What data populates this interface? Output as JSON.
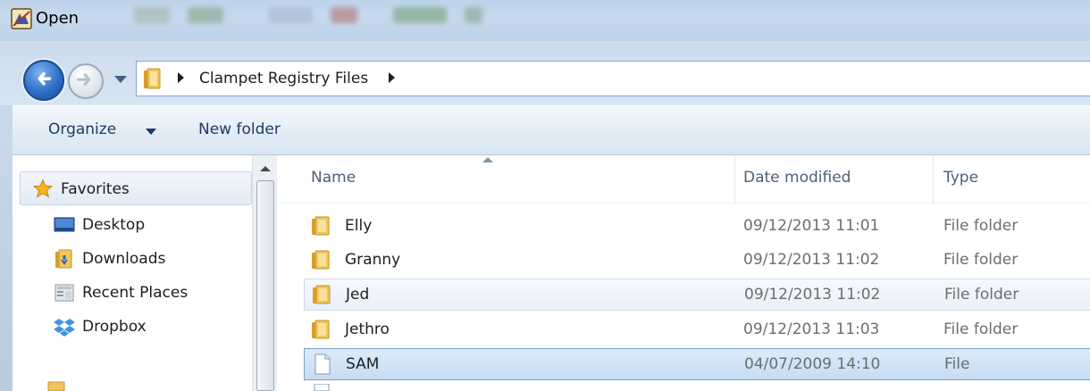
{
  "window": {
    "title": "Open"
  },
  "address": {
    "crumb": "Clampet Registry Files"
  },
  "toolbar": {
    "organize_label": "Organize",
    "new_folder_label": "New folder"
  },
  "navpane": {
    "items": [
      {
        "label": "Favorites",
        "icon": "star-icon"
      },
      {
        "label": "Desktop",
        "icon": "desktop-icon"
      },
      {
        "label": "Downloads",
        "icon": "downloads-icon"
      },
      {
        "label": "Recent Places",
        "icon": "recent-places-icon"
      },
      {
        "label": "Dropbox",
        "icon": "dropbox-icon"
      }
    ]
  },
  "filelist": {
    "columns": {
      "name": "Name",
      "date": "Date modified",
      "type": "Type"
    },
    "rows": [
      {
        "name": "Elly",
        "date": "09/12/2013 11:01",
        "type": "File folder",
        "icon": "folder-icon"
      },
      {
        "name": "Granny",
        "date": "09/12/2013 11:02",
        "type": "File folder",
        "icon": "folder-icon"
      },
      {
        "name": "Jed",
        "date": "09/12/2013 11:02",
        "type": "File folder",
        "icon": "folder-icon"
      },
      {
        "name": "Jethro",
        "date": "09/12/2013 11:03",
        "type": "File folder",
        "icon": "folder-icon"
      },
      {
        "name": "SAM",
        "date": "04/07/2009 14:10",
        "type": "File",
        "icon": "file-icon"
      }
    ]
  },
  "colors": {
    "accent": "#2f6fc7",
    "selection": "#c6dcf4",
    "folder": "#e8b84a"
  }
}
